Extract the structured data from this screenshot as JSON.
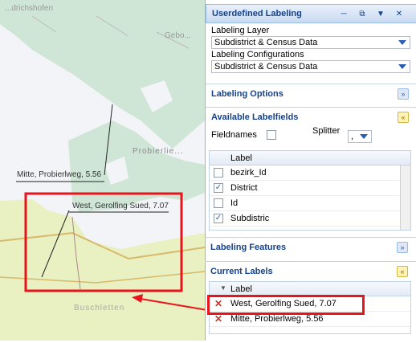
{
  "map": {
    "place_labels": [
      "...drichshofen",
      "Probierlie...",
      "Buschletten",
      "Gebo..."
    ],
    "label_mitte": "Mitte, Probierlweg, 5.56",
    "label_west": "West, Gerolfing Sued, 7.07"
  },
  "panel": {
    "title": "Userdefined Labeling",
    "labeling_layer": {
      "label": "Labeling Layer",
      "value": "Subdistrict & Census Data"
    },
    "labeling_config": {
      "label": "Labeling Configurations",
      "value": "Subdistrict & Census Data"
    },
    "sections": {
      "options": "Labeling Options",
      "available": "Available Labelfields",
      "features": "Labeling Features",
      "current": "Current Labels"
    },
    "fieldnames_label": "Fieldnames",
    "splitter_label": "Splitter",
    "splitter_value": ",",
    "available_header": "Label",
    "available_fields": [
      {
        "name": "bezirk_Id",
        "checked": false
      },
      {
        "name": "District",
        "checked": true
      },
      {
        "name": "Id",
        "checked": false
      },
      {
        "name": "Subdistric",
        "checked": true
      }
    ],
    "current_header": "Label",
    "current_labels": [
      "West, Gerolfing Sued, 7.07",
      "Mitte, Probierlweg, 5.56"
    ]
  },
  "colors": {
    "highlight": "#e8141b",
    "panel_title": "#15428b",
    "map_green": "#cfe6d6",
    "map_yellow": "#e9f0c2"
  }
}
